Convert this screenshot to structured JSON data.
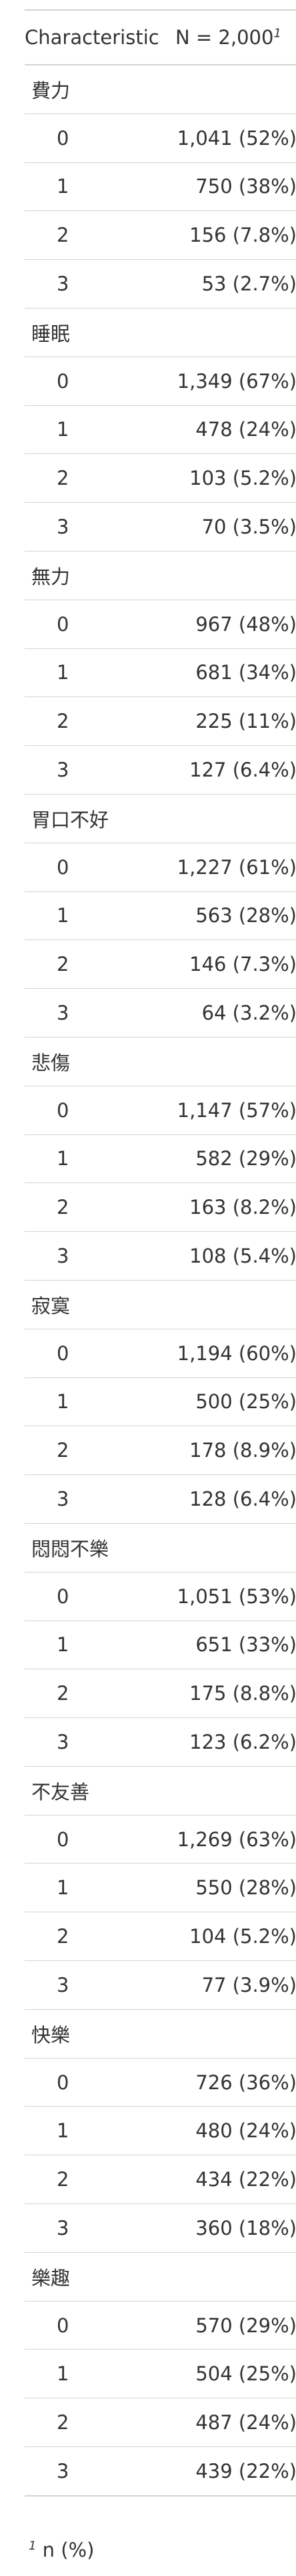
{
  "table": {
    "headers": {
      "characteristic": "Characteristic",
      "n": "N = 2,000",
      "n_footnote_mark": "1"
    },
    "groups": [
      {
        "label": "費力",
        "rows": [
          {
            "level": "0",
            "value": "1,041 (52%)"
          },
          {
            "level": "1",
            "value": "750 (38%)"
          },
          {
            "level": "2",
            "value": "156 (7.8%)"
          },
          {
            "level": "3",
            "value": "53 (2.7%)"
          }
        ]
      },
      {
        "label": "睡眠",
        "rows": [
          {
            "level": "0",
            "value": "1,349 (67%)"
          },
          {
            "level": "1",
            "value": "478 (24%)"
          },
          {
            "level": "2",
            "value": "103 (5.2%)"
          },
          {
            "level": "3",
            "value": "70 (3.5%)"
          }
        ]
      },
      {
        "label": "無力",
        "rows": [
          {
            "level": "0",
            "value": "967 (48%)"
          },
          {
            "level": "1",
            "value": "681 (34%)"
          },
          {
            "level": "2",
            "value": "225 (11%)"
          },
          {
            "level": "3",
            "value": "127 (6.4%)"
          }
        ]
      },
      {
        "label": "胃口不好",
        "rows": [
          {
            "level": "0",
            "value": "1,227 (61%)"
          },
          {
            "level": "1",
            "value": "563 (28%)"
          },
          {
            "level": "2",
            "value": "146 (7.3%)"
          },
          {
            "level": "3",
            "value": "64 (3.2%)"
          }
        ]
      },
      {
        "label": "悲傷",
        "rows": [
          {
            "level": "0",
            "value": "1,147 (57%)"
          },
          {
            "level": "1",
            "value": "582 (29%)"
          },
          {
            "level": "2",
            "value": "163 (8.2%)"
          },
          {
            "level": "3",
            "value": "108 (5.4%)"
          }
        ]
      },
      {
        "label": "寂寞",
        "rows": [
          {
            "level": "0",
            "value": "1,194 (60%)"
          },
          {
            "level": "1",
            "value": "500 (25%)"
          },
          {
            "level": "2",
            "value": "178 (8.9%)"
          },
          {
            "level": "3",
            "value": "128 (6.4%)"
          }
        ]
      },
      {
        "label": "悶悶不樂",
        "rows": [
          {
            "level": "0",
            "value": "1,051 (53%)"
          },
          {
            "level": "1",
            "value": "651 (33%)"
          },
          {
            "level": "2",
            "value": "175 (8.8%)"
          },
          {
            "level": "3",
            "value": "123 (6.2%)"
          }
        ]
      },
      {
        "label": "不友善",
        "rows": [
          {
            "level": "0",
            "value": "1,269 (63%)"
          },
          {
            "level": "1",
            "value": "550 (28%)"
          },
          {
            "level": "2",
            "value": "104 (5.2%)"
          },
          {
            "level": "3",
            "value": "77 (3.9%)"
          }
        ]
      },
      {
        "label": "快樂",
        "rows": [
          {
            "level": "0",
            "value": "726 (36%)"
          },
          {
            "level": "1",
            "value": "480 (24%)"
          },
          {
            "level": "2",
            "value": "434 (22%)"
          },
          {
            "level": "3",
            "value": "360 (18%)"
          }
        ]
      },
      {
        "label": "樂趣",
        "rows": [
          {
            "level": "0",
            "value": "570 (29%)"
          },
          {
            "level": "1",
            "value": "504 (25%)"
          },
          {
            "level": "2",
            "value": "487 (24%)"
          },
          {
            "level": "3",
            "value": "439 (22%)"
          }
        ]
      }
    ]
  },
  "footnote": {
    "mark": "1",
    "text": "n (%)"
  }
}
